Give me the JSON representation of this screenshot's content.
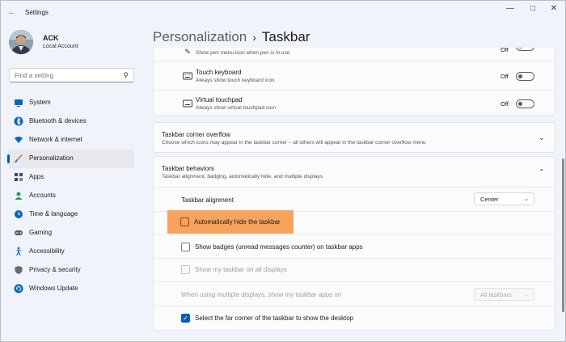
{
  "window": {
    "title": "Settings"
  },
  "user": {
    "initials": "ACK",
    "name": "ACK",
    "account_type": "Local Account"
  },
  "search": {
    "placeholder": "Find a setting"
  },
  "sidebar": {
    "items": [
      {
        "label": "System",
        "icon": "monitor-icon",
        "color": "#0067c0"
      },
      {
        "label": "Bluetooth & devices",
        "icon": "bluetooth-icon",
        "color": "#0067c0"
      },
      {
        "label": "Network & internet",
        "icon": "wifi-icon",
        "color": "#0067c0"
      },
      {
        "label": "Personalization",
        "icon": "brush-icon",
        "color": "#d06b2a",
        "active": true
      },
      {
        "label": "Apps",
        "icon": "apps-icon",
        "color": "#3a4a6b"
      },
      {
        "label": "Accounts",
        "icon": "person-icon",
        "color": "#2a9d5c"
      },
      {
        "label": "Time & language",
        "icon": "globe-clock-icon",
        "color": "#0067c0"
      },
      {
        "label": "Gaming",
        "icon": "gamepad-icon",
        "color": "#5b5b5b"
      },
      {
        "label": "Accessibility",
        "icon": "accessibility-icon",
        "color": "#1f6fd6"
      },
      {
        "label": "Privacy & security",
        "icon": "shield-icon",
        "color": "#6b6b6b"
      },
      {
        "label": "Windows Update",
        "icon": "update-icon",
        "color": "#0067c0"
      }
    ]
  },
  "breadcrumb": {
    "parent": "Personalization",
    "separator": "›",
    "current": "Taskbar"
  },
  "pen_row": {
    "subtitle": "Show pen menu icon when pen is in use",
    "state": "Off"
  },
  "touch_keyboard": {
    "title": "Touch keyboard",
    "subtitle": "Always show touch keyboard icon",
    "state": "Off"
  },
  "virtual_touchpad": {
    "title": "Virtual touchpad",
    "subtitle": "Always show virtual touchpad icon",
    "state": "Off"
  },
  "corner_overflow": {
    "title": "Taskbar corner overflow",
    "subtitle": "Choose which icons may appear in the taskbar corner – all others will appear in the taskbar corner overflow menu"
  },
  "behaviors": {
    "title": "Taskbar behaviors",
    "subtitle": "Taskbar alignment, badging, automatically hide, and multiple displays",
    "alignment_label": "Taskbar alignment",
    "alignment_value": "Center",
    "auto_hide_label": "Automatically hide the taskbar",
    "badges_label": "Show badges (unread messages counter) on taskbar apps",
    "all_displays_label": "Show my taskbar on all displays",
    "multi_display_label": "When using multiple displays, show my taskbar apps on",
    "multi_display_value": "All taskbars",
    "far_corner_label": "Select the far corner of the taskbar to show the desktop"
  },
  "colors": {
    "accent": "#005fb8",
    "highlight": "#f7a35c"
  }
}
